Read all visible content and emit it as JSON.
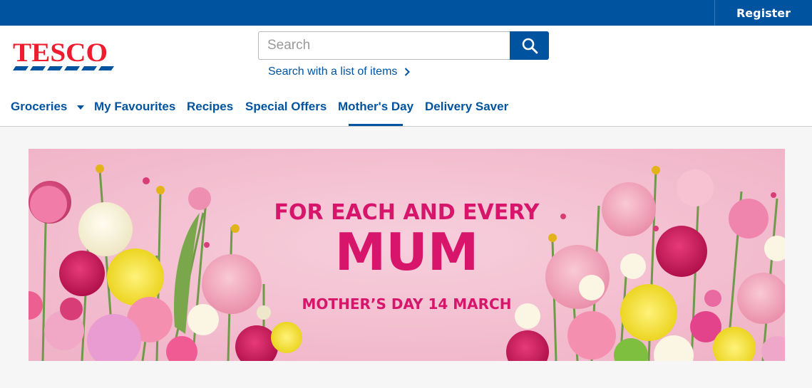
{
  "topbar": {
    "register_label": "Register"
  },
  "brand": {
    "logo_text": "TESCO"
  },
  "search": {
    "placeholder": "Search",
    "button_icon": "search-icon",
    "list_link": "Search with a list of items"
  },
  "nav": {
    "items": [
      {
        "label": "Groceries",
        "has_dropdown": true
      },
      {
        "label": "My Favourites"
      },
      {
        "label": "Recipes"
      },
      {
        "label": "Special Offers"
      },
      {
        "label": "Mother's Day",
        "active": true
      },
      {
        "label": "Delivery Saver"
      }
    ]
  },
  "banner": {
    "line1": "FOR EACH AND EVERY",
    "line2": "MUM",
    "line3": "MOTHER’S DAY 14 MARCH"
  },
  "colors": {
    "brand_blue": "#00539f",
    "brand_red": "#ee1c2e",
    "banner_text": "#d6156b",
    "banner_bg": "#f3bdd0"
  }
}
